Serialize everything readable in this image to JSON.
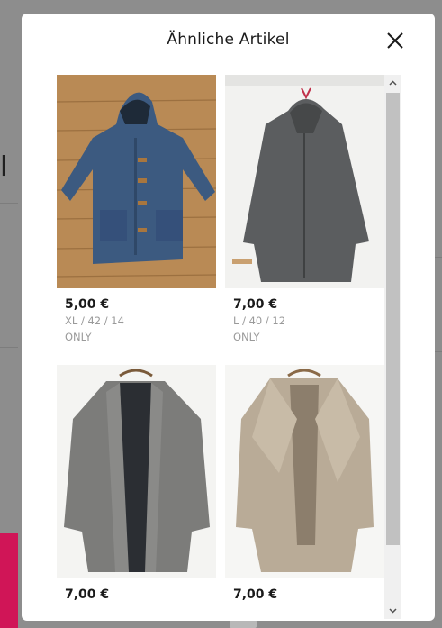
{
  "background": {
    "partial_letter": "l"
  },
  "modal": {
    "title": "Ähnliche Artikel",
    "close_icon": "close-icon"
  },
  "items": [
    {
      "price": "5,00 €",
      "size": "XL / 42 / 14",
      "brand": "ONLY",
      "image": "navy duffle coat photo"
    },
    {
      "price": "7,00 €",
      "size": "L / 40 / 12",
      "brand": "ONLY",
      "image": "grey hooded coat photo"
    },
    {
      "price": "7,00 €",
      "size": "",
      "brand": "",
      "image": "grey tweed coat photo"
    },
    {
      "price": "7,00 €",
      "size": "",
      "brand": "",
      "image": "beige wrap coat photo"
    }
  ],
  "scrollbar": {
    "up_icon": "chevron-up-icon",
    "down_icon": "chevron-down-icon"
  },
  "colors": {
    "overlay": "#8d8d8d",
    "accent_pink": "#d01557",
    "price_text": "#1a1a1a",
    "meta_text": "#9a9a9a"
  }
}
